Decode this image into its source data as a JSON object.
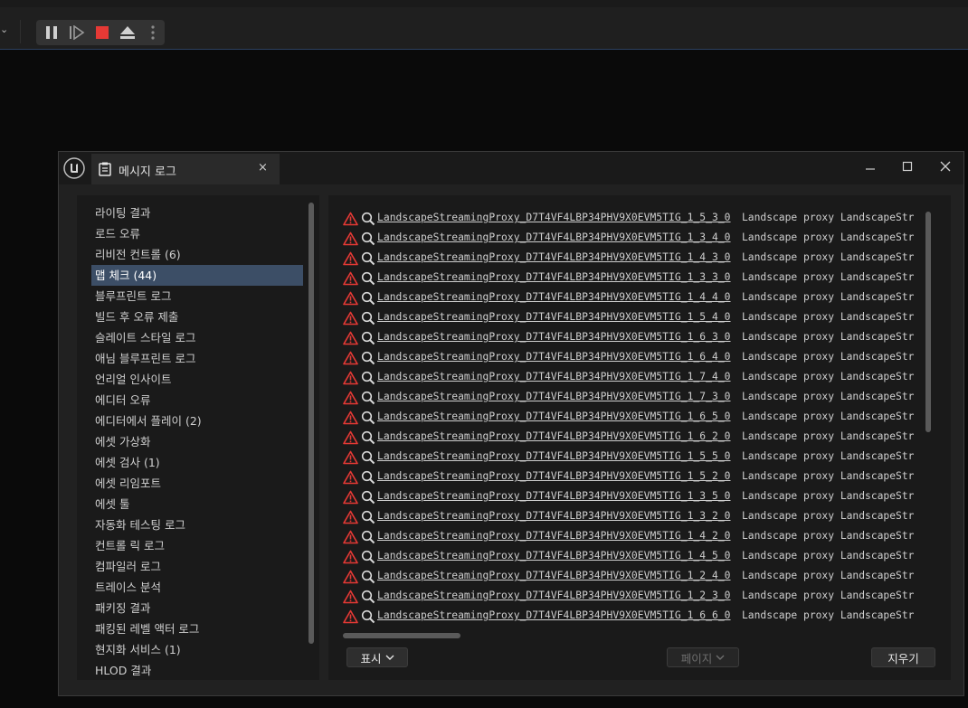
{
  "toolbar": {
    "buttons": [
      "pause-icon",
      "step-frame-icon",
      "stop-icon",
      "eject-icon",
      "more-icon"
    ],
    "colors": {
      "stop": "#e53935"
    }
  },
  "window": {
    "tab_title": "메시지 로그",
    "tab_close": "×"
  },
  "categories": [
    {
      "label": "라이팅 결과",
      "selected": false
    },
    {
      "label": "로드 오류",
      "selected": false
    },
    {
      "label": "리비전 컨트롤 (6)",
      "selected": false
    },
    {
      "label": "맵 체크 (44)",
      "selected": true
    },
    {
      "label": "블루프린트 로그",
      "selected": false
    },
    {
      "label": "빌드 후 오류 제출",
      "selected": false
    },
    {
      "label": "슬레이트 스타일 로그",
      "selected": false
    },
    {
      "label": "애님 블루프린트 로그",
      "selected": false
    },
    {
      "label": "언리얼 인사이트",
      "selected": false
    },
    {
      "label": "에디터 오류",
      "selected": false
    },
    {
      "label": "에디터에서 플레이 (2)",
      "selected": false
    },
    {
      "label": "에셋 가상화",
      "selected": false
    },
    {
      "label": "에셋 검사 (1)",
      "selected": false
    },
    {
      "label": "에셋 리임포트",
      "selected": false
    },
    {
      "label": "에셋 툴",
      "selected": false
    },
    {
      "label": "자동화 테스팅 로그",
      "selected": false
    },
    {
      "label": "컨트롤 릭 로그",
      "selected": false
    },
    {
      "label": "컴파일러 로그",
      "selected": false
    },
    {
      "label": "트레이스 분석",
      "selected": false
    },
    {
      "label": "패키징 결과",
      "selected": false
    },
    {
      "label": "패킹된 레벨 액터 로그",
      "selected": false
    },
    {
      "label": "현지화 서비스 (1)",
      "selected": false
    },
    {
      "label": "HLOD 결과",
      "selected": false
    }
  ],
  "messages": [
    {
      "object": "LandscapeStreamingProxy_D7T4VF4LBP34PHV9X0EVM5TIG_1_5_3_0",
      "text": "Landscape proxy LandscapeStr"
    },
    {
      "object": "LandscapeStreamingProxy_D7T4VF4LBP34PHV9X0EVM5TIG_1_3_4_0",
      "text": "Landscape proxy LandscapeStr"
    },
    {
      "object": "LandscapeStreamingProxy_D7T4VF4LBP34PHV9X0EVM5TIG_1_4_3_0",
      "text": "Landscape proxy LandscapeStr"
    },
    {
      "object": "LandscapeStreamingProxy_D7T4VF4LBP34PHV9X0EVM5TIG_1_3_3_0",
      "text": "Landscape proxy LandscapeStr"
    },
    {
      "object": "LandscapeStreamingProxy_D7T4VF4LBP34PHV9X0EVM5TIG_1_4_4_0",
      "text": "Landscape proxy LandscapeStr"
    },
    {
      "object": "LandscapeStreamingProxy_D7T4VF4LBP34PHV9X0EVM5TIG_1_5_4_0",
      "text": "Landscape proxy LandscapeStr"
    },
    {
      "object": "LandscapeStreamingProxy_D7T4VF4LBP34PHV9X0EVM5TIG_1_6_3_0",
      "text": "Landscape proxy LandscapeStr"
    },
    {
      "object": "LandscapeStreamingProxy_D7T4VF4LBP34PHV9X0EVM5TIG_1_6_4_0",
      "text": "Landscape proxy LandscapeStr"
    },
    {
      "object": "LandscapeStreamingProxy_D7T4VF4LBP34PHV9X0EVM5TIG_1_7_4_0",
      "text": "Landscape proxy LandscapeStr"
    },
    {
      "object": "LandscapeStreamingProxy_D7T4VF4LBP34PHV9X0EVM5TIG_1_7_3_0",
      "text": "Landscape proxy LandscapeStr"
    },
    {
      "object": "LandscapeStreamingProxy_D7T4VF4LBP34PHV9X0EVM5TIG_1_6_5_0",
      "text": "Landscape proxy LandscapeStr"
    },
    {
      "object": "LandscapeStreamingProxy_D7T4VF4LBP34PHV9X0EVM5TIG_1_6_2_0",
      "text": "Landscape proxy LandscapeStr"
    },
    {
      "object": "LandscapeStreamingProxy_D7T4VF4LBP34PHV9X0EVM5TIG_1_5_5_0",
      "text": "Landscape proxy LandscapeStr"
    },
    {
      "object": "LandscapeStreamingProxy_D7T4VF4LBP34PHV9X0EVM5TIG_1_5_2_0",
      "text": "Landscape proxy LandscapeStr"
    },
    {
      "object": "LandscapeStreamingProxy_D7T4VF4LBP34PHV9X0EVM5TIG_1_3_5_0",
      "text": "Landscape proxy LandscapeStr"
    },
    {
      "object": "LandscapeStreamingProxy_D7T4VF4LBP34PHV9X0EVM5TIG_1_3_2_0",
      "text": "Landscape proxy LandscapeStr"
    },
    {
      "object": "LandscapeStreamingProxy_D7T4VF4LBP34PHV9X0EVM5TIG_1_4_2_0",
      "text": "Landscape proxy LandscapeStr"
    },
    {
      "object": "LandscapeStreamingProxy_D7T4VF4LBP34PHV9X0EVM5TIG_1_4_5_0",
      "text": "Landscape proxy LandscapeStr"
    },
    {
      "object": "LandscapeStreamingProxy_D7T4VF4LBP34PHV9X0EVM5TIG_1_2_4_0",
      "text": "Landscape proxy LandscapeStr"
    },
    {
      "object": "LandscapeStreamingProxy_D7T4VF4LBP34PHV9X0EVM5TIG_1_2_3_0",
      "text": "Landscape proxy LandscapeStr"
    },
    {
      "object": "LandscapeStreamingProxy_D7T4VF4LBP34PHV9X0EVM5TIG_1_6_6_0",
      "text": "Landscape proxy LandscapeStr"
    }
  ],
  "footer": {
    "show_label": "표시",
    "page_label": "페이지",
    "clear_label": "지우기"
  },
  "colors": {
    "warning": "#e53935",
    "selection": "#3c4e66"
  }
}
